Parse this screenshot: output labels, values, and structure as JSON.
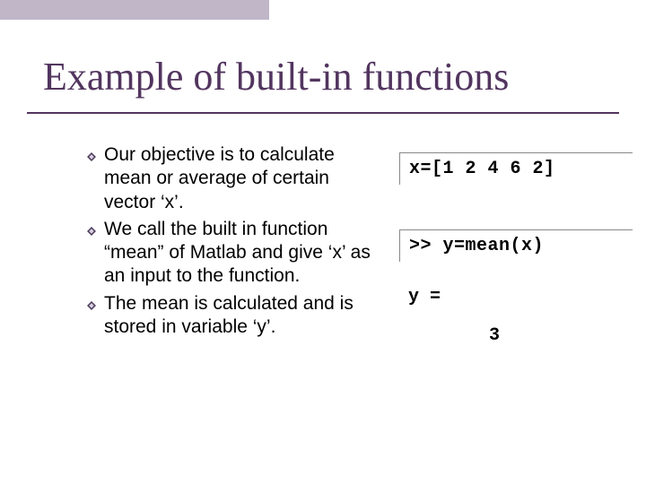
{
  "title": "Example of built-in functions",
  "bullets": {
    "b1": "Our objective is to calculate mean or average of certain vector ‘x’.",
    "b2": "We call the built in function “mean” of Matlab and give ‘x’ as an input to the function.",
    "b3": "The mean is calculated and is stored in variable ‘y’."
  },
  "code": {
    "line1": "x=[1 2 4 6 2]",
    "line2": ">> y=mean(x)",
    "result_label": "y =",
    "result_value": "3"
  }
}
